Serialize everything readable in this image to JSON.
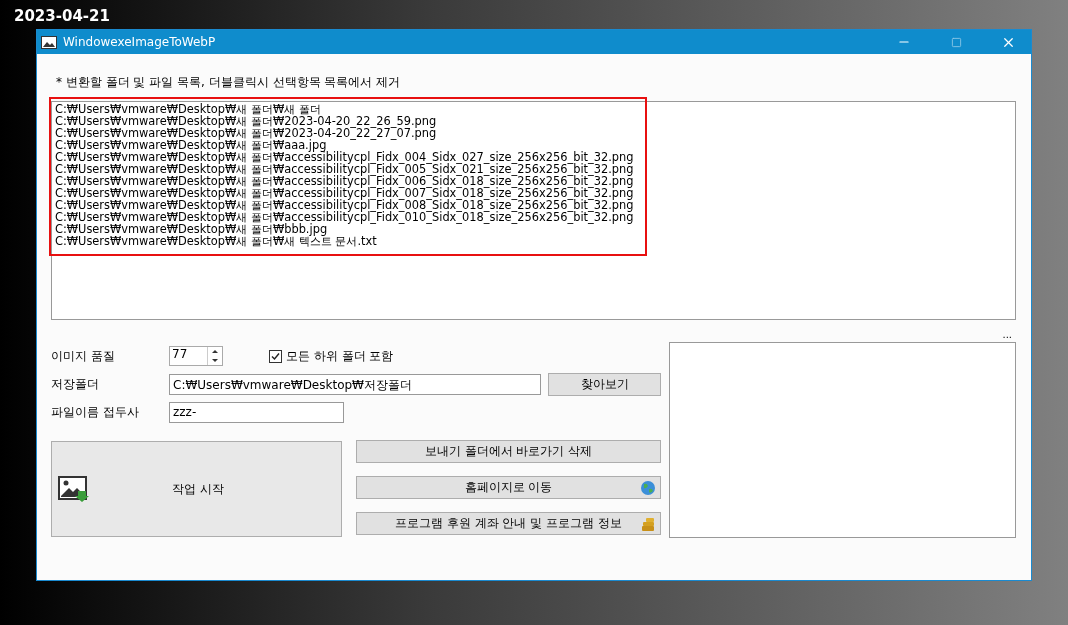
{
  "date": "2023-04-21",
  "window": {
    "title": "WindowexeImageToWebP"
  },
  "instructions": "* 변환할 폴더 및 파일 목록, 더블클릭시 선택항목 목록에서 제거",
  "file_list": {
    "highlighted": true,
    "items": [
      "C:₩Users₩vmware₩Desktop₩새 폴더₩새 폴더",
      "C:₩Users₩vmware₩Desktop₩새 폴더₩2023-04-20_22_26_59.png",
      "C:₩Users₩vmware₩Desktop₩새 폴더₩2023-04-20_22_27_07.png",
      "C:₩Users₩vmware₩Desktop₩새 폴더₩aaa.jpg",
      "C:₩Users₩vmware₩Desktop₩새 폴더₩accessibilitycpl_Fidx_004_Sidx_027_size_256x256_bit_32.png",
      "C:₩Users₩vmware₩Desktop₩새 폴더₩accessibilitycpl_Fidx_005_Sidx_021_size_256x256_bit_32.png",
      "C:₩Users₩vmware₩Desktop₩새 폴더₩accessibilitycpl_Fidx_006_Sidx_018_size_256x256_bit_32.png",
      "C:₩Users₩vmware₩Desktop₩새 폴더₩accessibilitycpl_Fidx_007_Sidx_018_size_256x256_bit_32.png",
      "C:₩Users₩vmware₩Desktop₩새 폴더₩accessibilitycpl_Fidx_008_Sidx_018_size_256x256_bit_32.png",
      "C:₩Users₩vmware₩Desktop₩새 폴더₩accessibilitycpl_Fidx_010_Sidx_018_size_256x256_bit_32.png",
      "C:₩Users₩vmware₩Desktop₩새 폴더₩bbb.jpg",
      "C:₩Users₩vmware₩Desktop₩새 폴더₩새 텍스트 문서.txt"
    ]
  },
  "quality": {
    "label": "이미지 품질",
    "value": "77"
  },
  "include_subfolders": {
    "label": "모든 하위 폴더 포함",
    "checked": true
  },
  "save_folder": {
    "label": "저장폴더",
    "value": "C:₩Users₩vmware₩Desktop₩저장폴더",
    "browse": "찾아보기"
  },
  "prefix": {
    "label": "파일이름 접두사",
    "value": "zzz-"
  },
  "start_button": "작업 시작",
  "buttons": [
    {
      "label": "보내기 폴더에서 바로가기 삭제",
      "kind": "plain"
    },
    {
      "label": "홈페이지로 이동",
      "kind": "web"
    },
    {
      "label": "프로그램 후원 계좌 안내 및 프로그램 정보",
      "kind": "info"
    }
  ],
  "ellipsis": "..."
}
